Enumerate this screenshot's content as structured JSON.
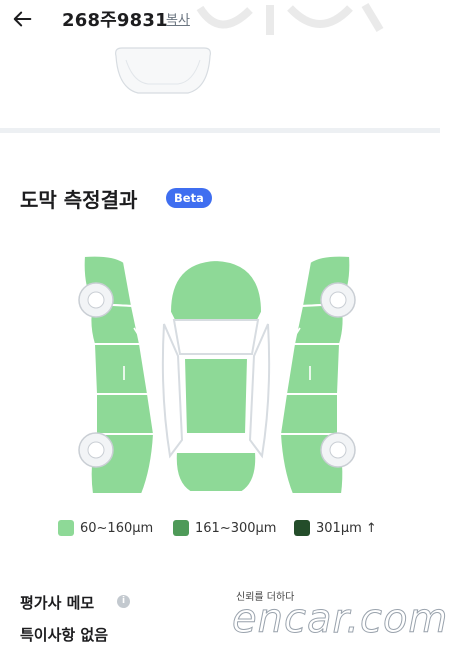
{
  "header": {
    "plate_number": "268주9831",
    "copy_label": "복사",
    "back_icon": "arrow-left-icon"
  },
  "section": {
    "title": "도막 측정결과",
    "badge": "Beta"
  },
  "legend": [
    {
      "label": "60~160μm",
      "color": "#8ed997"
    },
    {
      "label": "161~300μm",
      "color": "#4e9a58"
    },
    {
      "label": "301μm ↑",
      "color": "#244d2a"
    }
  ],
  "diagram": {
    "panel_color": "#8ed997",
    "outline_color": "#ffffff"
  },
  "memo": {
    "title": "평가사 메모",
    "info_icon": "info-icon",
    "text": "특이사항 없음"
  },
  "watermark": {
    "tagline": "신뢰를 더하다",
    "logo_text": "encar.com"
  }
}
